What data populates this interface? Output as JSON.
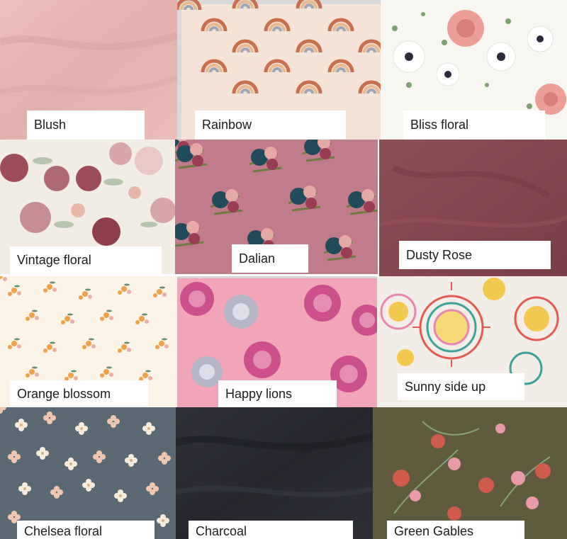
{
  "swatches": [
    {
      "id": "blush",
      "name": "Blush",
      "colors": {
        "base": "#e8b7b3",
        "shade": "#d7a09d"
      }
    },
    {
      "id": "rainbow",
      "name": "Rainbow",
      "colors": {
        "base": "#f6e3d7",
        "arc1": "#c8704d",
        "arc2": "#e7b98f",
        "arc3": "#9fa7b4"
      }
    },
    {
      "id": "bliss-floral",
      "name": "Bliss floral",
      "colors": {
        "base": "#f7f6f1",
        "rose": "#ec9f97",
        "leaf": "#7da06f",
        "dark": "#2e2a3a"
      }
    },
    {
      "id": "vintage-floral",
      "name": "Vintage floral",
      "colors": {
        "base": "#f1ece4",
        "bloom": "#9c4d57",
        "bloom2": "#d9a6a8",
        "leaf": "#a9bba0"
      }
    },
    {
      "id": "dalian",
      "name": "Dalian",
      "colors": {
        "base": "#c07c8b",
        "teal": "#1f4b5c",
        "pink": "#e6a8a3",
        "leaf": "#6f7d3e"
      }
    },
    {
      "id": "dusty-rose",
      "name": "Dusty Rose",
      "colors": {
        "base": "#8a4a52",
        "shade": "#6f3940"
      }
    },
    {
      "id": "orange-blossom",
      "name": "Orange blossom",
      "colors": {
        "base": "#fcf4e6",
        "flower": "#f0a14a",
        "pink": "#eab0a7",
        "leaf": "#6a8f6e"
      }
    },
    {
      "id": "happy-lions",
      "name": "Happy lions",
      "colors": {
        "base": "#f2a4b9",
        "magenta": "#cd4f8c",
        "grey": "#b4b5c7"
      }
    },
    {
      "id": "sunny-side-up",
      "name": "Sunny side up",
      "colors": {
        "base": "#f2ede6",
        "sun": "#f3c84f",
        "red": "#e55a4f",
        "teal": "#3aa39a",
        "pink": "#e986b0"
      }
    },
    {
      "id": "chelsea-floral",
      "name": "Chelsea floral",
      "colors": {
        "base": "#5b6974",
        "flower": "#f6ecdd",
        "peach": "#f0c6ae"
      }
    },
    {
      "id": "charcoal",
      "name": "Charcoal",
      "colors": {
        "base": "#2b2c33",
        "shade": "#1d1e24"
      }
    },
    {
      "id": "green-gables",
      "name": "Green Gables",
      "colors": {
        "base": "#5e5b3f",
        "red": "#d05a4c",
        "pink": "#e99aa9",
        "leaf": "#8aa07a"
      }
    }
  ]
}
